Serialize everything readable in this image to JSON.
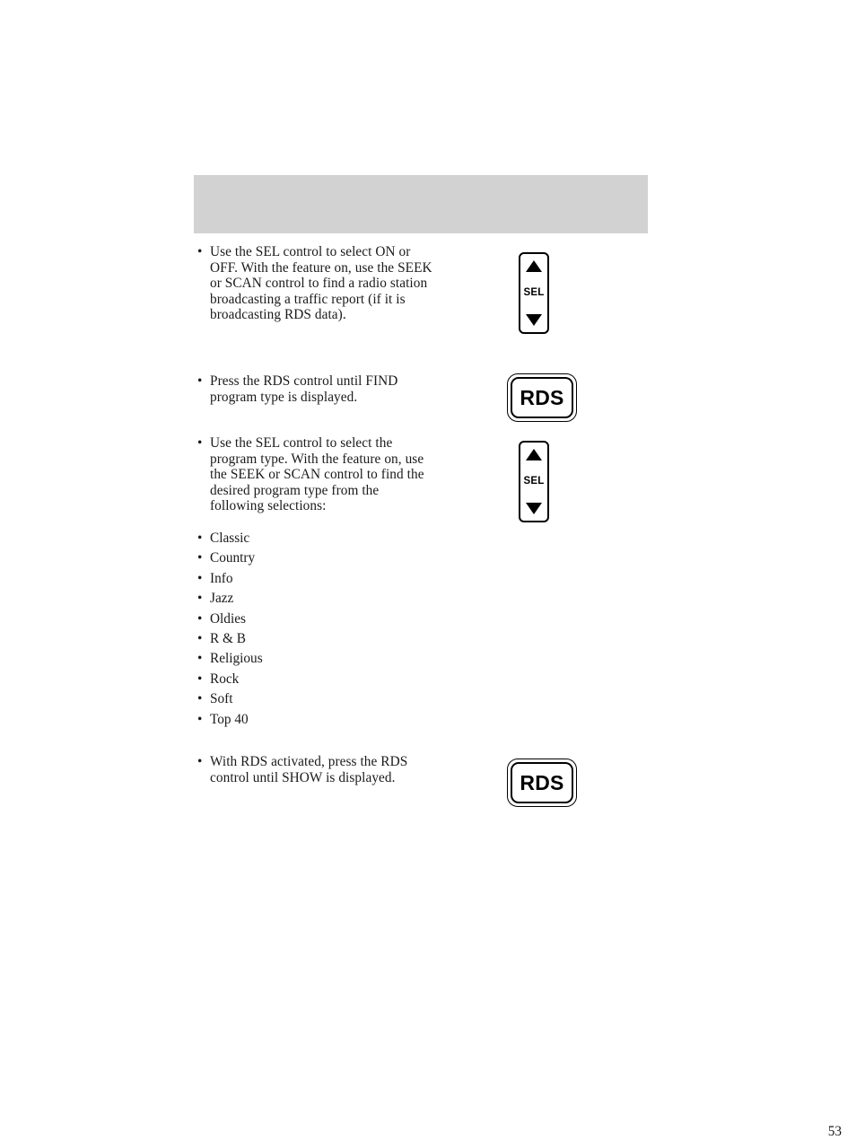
{
  "document": {
    "page_number": "53"
  },
  "header_band": {
    "label": ""
  },
  "steps": [
    {
      "bullet": "•",
      "text": "Use the SEL control to select ON or OFF. With the feature on, use the SEEK or SCAN control to find a radio station broadcasting a traffic report (if it is broadcasting RDS data).",
      "control": {
        "type": "sel-rocker",
        "label": "SEL",
        "up_icon": "triangle-up-icon",
        "down_icon": "triangle-down-icon"
      }
    },
    {
      "bullet": "•",
      "text": "Press the RDS control until FIND program type is displayed.",
      "control": {
        "type": "rds-button",
        "label": "RDS"
      }
    },
    {
      "bullet": "•",
      "text": "Use the SEL control to select the program type. With the feature on, use the SEEK or SCAN control to find the desired program type from the following selections:",
      "control": {
        "type": "sel-rocker",
        "label": "SEL",
        "up_icon": "triangle-up-icon",
        "down_icon": "triangle-down-icon"
      }
    },
    {
      "bullet": "•",
      "text": "With RDS activated, press the RDS control until SHOW is displayed.",
      "control": {
        "type": "rds-button",
        "label": "RDS"
      }
    }
  ],
  "program_types": {
    "bullet": "•",
    "items": [
      "Classic",
      "Country",
      "Info",
      "Jazz",
      "Oldies",
      "R & B",
      "Religious",
      "Rock",
      "Soft",
      "Top 40"
    ]
  },
  "colors": {
    "header_band": "#d2d2d2",
    "ink": "#1a1a1a",
    "art_stroke": "#000000",
    "page_background": "#ffffff"
  }
}
